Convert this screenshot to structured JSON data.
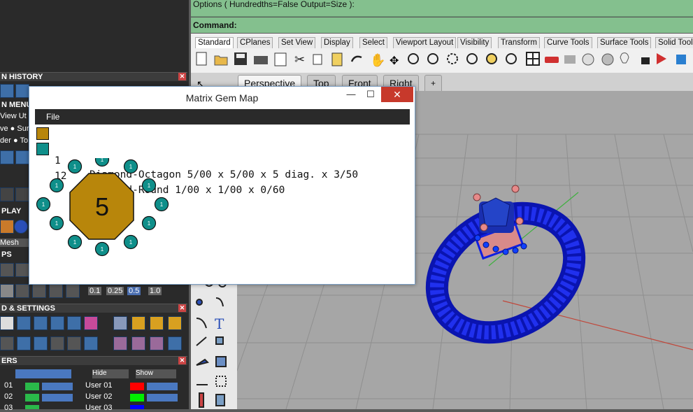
{
  "options_bar": {
    "text": "Options ( Hundredths=False  Output=Size ):"
  },
  "command_bar": {
    "text": "Command:"
  },
  "toolbar": {
    "tabs": [
      "Standard",
      "CPlanes",
      "Set View",
      "Display",
      "Select",
      "Viewport Layout",
      "Visibility",
      "Transform",
      "Curve Tools",
      "Surface Tools",
      "Solid Tool"
    ]
  },
  "viewport_tabs": [
    "Perspective",
    "Top",
    "Front",
    "Right",
    "+"
  ],
  "left_panel": {
    "history_header": "N HISTORY",
    "menu_header": "N MENU",
    "menu_row1": "View  Ut",
    "menu_row2": "ve  ● Sur",
    "menu_row3": "der ● To",
    "display_header": "PLAY",
    "mesh_label": "Mesh",
    "ps_header": "PS",
    "scale_values": [
      "0.1",
      "0.25",
      "0.5",
      "1.0"
    ],
    "settings_header": "D & SETTINGS",
    "layers_header": "ERS",
    "hide_label": "Hide",
    "show_label": "Show",
    "layer_rows": [
      {
        "left_num": "01",
        "right_name": "User 01",
        "left_color": "#2ab94a",
        "right_color": "#ff0000"
      },
      {
        "left_num": "02",
        "right_name": "User 02",
        "left_color": "#2ab94a",
        "right_color": "#00ee00"
      },
      {
        "left_num": "03",
        "right_name": "User 03",
        "left_color": "#2ab94a",
        "right_color": "#0000ff"
      }
    ]
  },
  "dialog": {
    "title": "Matrix Gem Map",
    "minimize": "—",
    "maximize": "☐",
    "close": "✕",
    "menu_file": "File",
    "gems": [
      {
        "count": "1",
        "description": "Diamond-Octagon 5/00 x 5/00 x 5 diag. x 3/50",
        "color": "#b8860b"
      },
      {
        "count": "12",
        "description": "Diamond-Round 1/00 x 1/00 x 0/60",
        "color": "#0f8f8a"
      }
    ],
    "center_stone_label": "5",
    "small_stone_label": "1"
  },
  "colors": {
    "green_bar": "#84c08e",
    "octagon": "#b8860b",
    "round": "#0f8f8a",
    "ring_blue": "#1020e0"
  }
}
